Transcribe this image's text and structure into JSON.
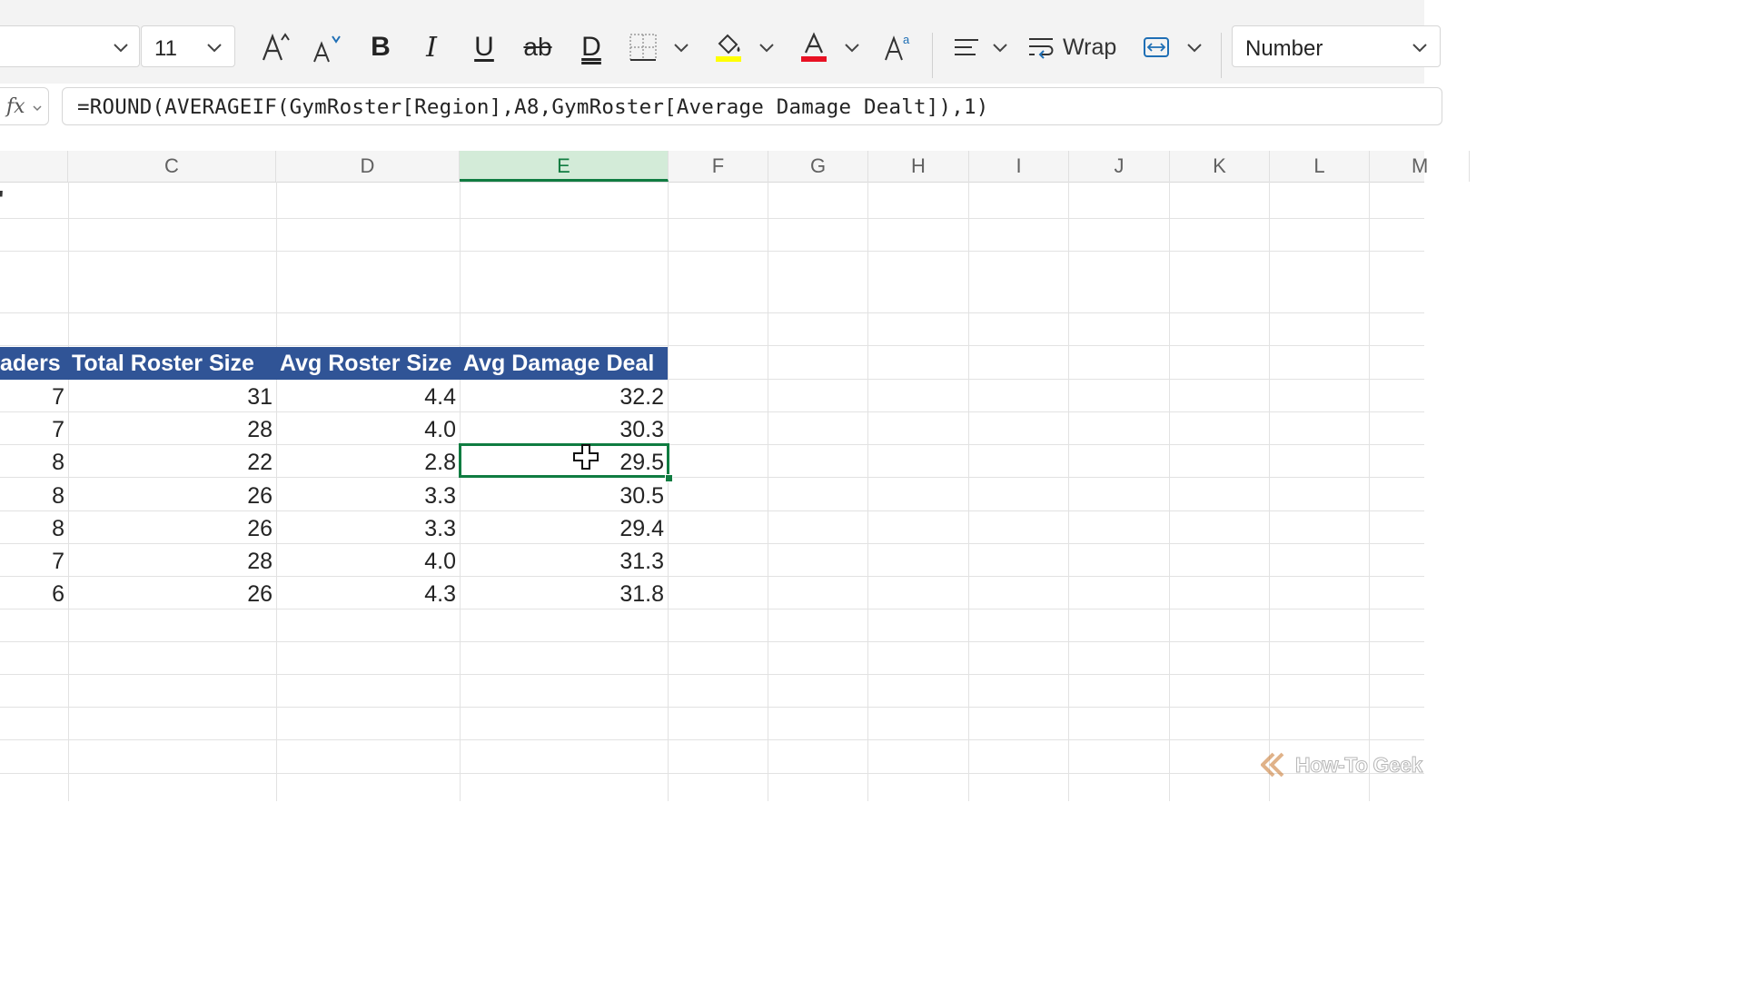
{
  "ribbon": {
    "font_size": "11",
    "wrap_label": "Wrap",
    "number_format": "Number",
    "icons": [
      "increase-font-icon",
      "decrease-font-icon",
      "bold-icon",
      "italic-icon",
      "underline-icon",
      "strikethrough-icon",
      "double-underline-icon",
      "borders-icon",
      "fill-color-icon",
      "font-color-icon",
      "text-effects-icon",
      "align-icon",
      "wrap-icon",
      "merge-icon"
    ],
    "fill_color": "#ffff00",
    "font_color": "#e81123"
  },
  "formula_bar": {
    "fx_label": "fx",
    "formula": "=ROUND(AVERAGEIF(GymRoster[Region],A8,GymRoster[Average Damage Dealt]),1)"
  },
  "grid": {
    "columns": [
      "C",
      "D",
      "E",
      "F",
      "G",
      "H",
      "I",
      "J",
      "K",
      "L",
      "M"
    ],
    "partial_first_col_text": "'",
    "selected_column": "E",
    "table_headers": [
      "aders",
      "Total Roster Size",
      "Avg Roster Size",
      "Avg Damage Deal"
    ],
    "rows": [
      [
        "7",
        "31",
        "4.4",
        "32.2"
      ],
      [
        "7",
        "28",
        "4.0",
        "30.3"
      ],
      [
        "8",
        "22",
        "2.8",
        "29.5"
      ],
      [
        "8",
        "26",
        "3.3",
        "30.5"
      ],
      [
        "8",
        "26",
        "3.3",
        "29.4"
      ],
      [
        "7",
        "28",
        "4.0",
        "31.3"
      ],
      [
        "6",
        "26",
        "4.3",
        "31.8"
      ]
    ],
    "header_color": "#305496",
    "selection_color": "#107c41"
  },
  "watermark": {
    "text": "How-To Geek"
  }
}
